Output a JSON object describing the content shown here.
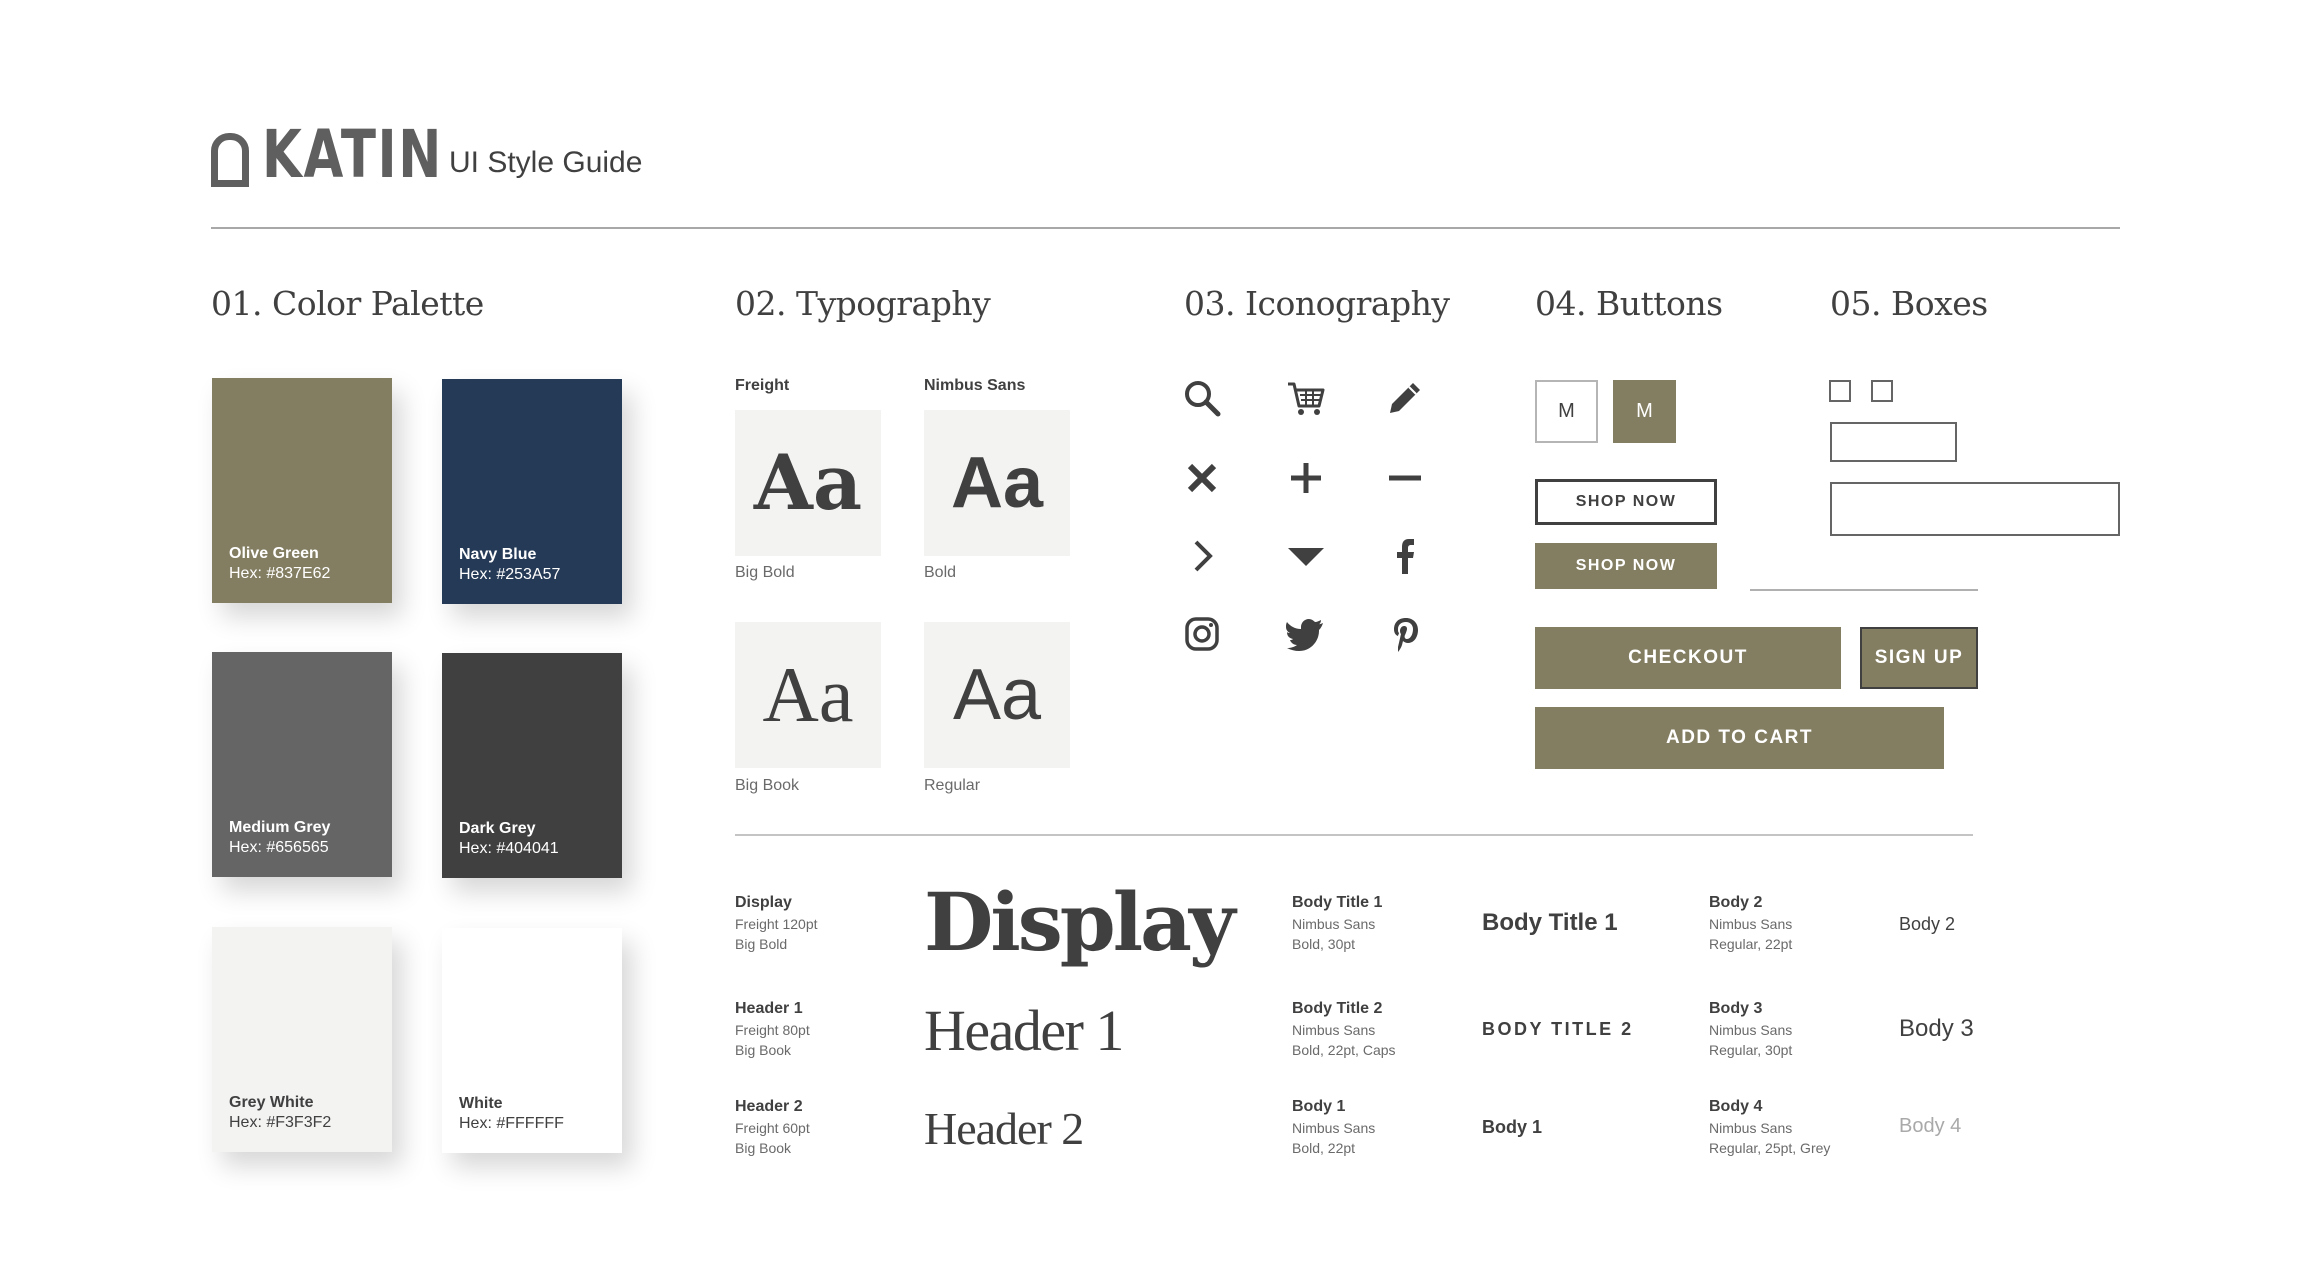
{
  "header": {
    "brand": "KATIN",
    "title": "UI Style Guide"
  },
  "sections": {
    "color": "01. Color Palette",
    "typography": "02. Typography",
    "iconography": "03. Iconography",
    "buttons": "04. Buttons",
    "boxes": "05. Boxes"
  },
  "colors": [
    {
      "name": "Olive Green",
      "hex": "Hex: #837E62",
      "value": "#837E62",
      "text": "#FFFFFF"
    },
    {
      "name": "Navy Blue",
      "hex": "Hex: #253A57",
      "value": "#253A57",
      "text": "#FFFFFF"
    },
    {
      "name": "Medium Grey",
      "hex": "Hex: #656565",
      "value": "#656565",
      "text": "#FFFFFF"
    },
    {
      "name": "Dark Grey",
      "hex": "Hex: #404041",
      "value": "#404041",
      "text": "#FFFFFF"
    },
    {
      "name": "Grey White",
      "hex": "Hex: #F3F3F2",
      "value": "#F3F3F2",
      "text": "#404041"
    },
    {
      "name": "White",
      "hex": "Hex: #FFFFFF",
      "value": "#FFFFFF",
      "text": "#404041"
    }
  ],
  "typography": {
    "font1": "Freight",
    "font2": "Nimbus Sans",
    "sample": "Aa",
    "tiles": [
      "Big Bold",
      "Bold",
      "Big Book",
      "Regular"
    ]
  },
  "icons": [
    "search-icon",
    "cart-icon",
    "pencil-icon",
    "close-icon",
    "plus-icon",
    "minus-icon",
    "chevron-right-icon",
    "caret-down-icon",
    "facebook-icon",
    "instagram-icon",
    "twitter-icon",
    "pinterest-icon"
  ],
  "buttons": {
    "size_outline": "M",
    "size_filled": "M",
    "shop_now_outline": "SHOP NOW",
    "shop_now_filled": "SHOP NOW",
    "checkout": "CHECKOUT",
    "sign_up": "SIGN UP",
    "add_to_cart": "ADD TO CART"
  },
  "specimens": {
    "display": {
      "name": "Display",
      "line1": "Freight 120pt",
      "line2": "Big Bold",
      "sample": "Display"
    },
    "header1": {
      "name": "Header 1",
      "line1": "Freight 80pt",
      "line2": "Big Book",
      "sample": "Header 1"
    },
    "header2": {
      "name": "Header 2",
      "line1": "Freight 60pt",
      "line2": "Big Book",
      "sample": "Header 2"
    },
    "body_title1": {
      "name": "Body Title 1",
      "line1": "Nimbus Sans",
      "line2": "Bold,  30pt",
      "sample": "Body Title 1"
    },
    "body_title2": {
      "name": "Body Title 2",
      "line1": "Nimbus Sans",
      "line2": "Bold, 22pt, Caps",
      "sample": "BODY TITLE 2"
    },
    "body1": {
      "name": "Body 1",
      "line1": "Nimbus Sans",
      "line2": "Bold, 22pt",
      "sample": "Body 1"
    },
    "body2": {
      "name": "Body 2",
      "line1": "Nimbus Sans",
      "line2": "Regular,  22pt",
      "sample": "Body 2"
    },
    "body3": {
      "name": "Body 3",
      "line1": "Nimbus Sans",
      "line2": "Regular, 30pt",
      "sample": "Body 3"
    },
    "body4": {
      "name": "Body 4",
      "line1": "Nimbus Sans",
      "line2": "Regular, 25pt, Grey",
      "sample": "Body 4"
    }
  }
}
